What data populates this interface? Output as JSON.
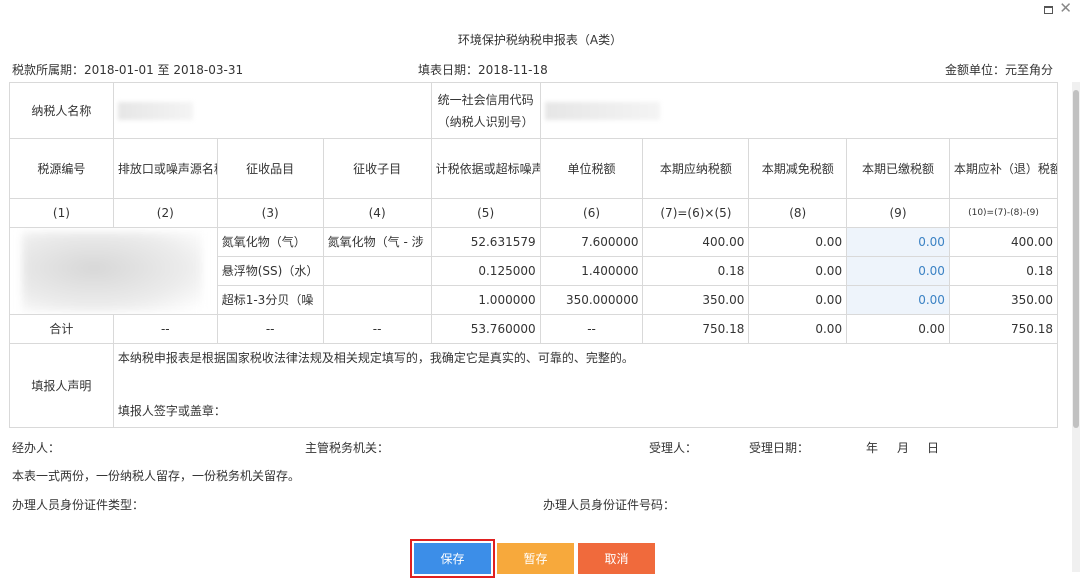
{
  "window": {
    "maximize_icon": "maximize-icon",
    "close_icon": "close-icon",
    "close_glyph": "✕"
  },
  "title": "环境保护税纳税申报表（A类）",
  "period": "税款所属期：2018-01-01 至 2018-03-31",
  "fill_date": "填表日期：2018-11-18",
  "unit": "金额单位：元至角分",
  "taxpayer": {
    "name_label": "纳税人名称",
    "credit_code_label_1": "统一社会信用代码",
    "credit_code_label_2": "（纳税人识别号）"
  },
  "headers": [
    "税源编号",
    "排放口或噪声源名称",
    "征收品目",
    "征收子目",
    "计税依据或超标噪声综合系数",
    "单位税额",
    "本期应纳税额",
    "本期减免税额",
    "本期已缴税额",
    "本期应补（退）税额"
  ],
  "header_index": [
    "(1)",
    "(2)",
    "(3)",
    "(4)",
    "(5)",
    "(6)",
    "(7)=(6)×(5)",
    "(8)",
    "(9)",
    "(10)=(7)-(8)-(9)"
  ],
  "rows": [
    {
      "item": "氮氧化物（气）",
      "subitem": "氮氧化物（气 - 涉",
      "basis": "52.631579",
      "unit_tax": "7.600000",
      "payable": "400.00",
      "reduced": "0.00",
      "paid": "0.00",
      "due": "400.00"
    },
    {
      "item": "悬浮物(SS)（水）",
      "subitem": "",
      "basis": "0.125000",
      "unit_tax": "1.400000",
      "payable": "0.18",
      "reduced": "0.00",
      "paid": "0.00",
      "due": "0.18"
    },
    {
      "item": "超标1-3分贝（噪",
      "subitem": "",
      "basis": "1.000000",
      "unit_tax": "350.000000",
      "payable": "350.00",
      "reduced": "0.00",
      "paid": "0.00",
      "due": "350.00"
    }
  ],
  "total": {
    "label": "合计",
    "c2": "--",
    "c3": "--",
    "c4": "--",
    "basis": "53.760000",
    "unit_tax": "--",
    "payable": "750.18",
    "reduced": "0.00",
    "paid": "0.00",
    "due": "750.18"
  },
  "declaration": {
    "label": "填报人声明",
    "text": "本纳税申报表是根据国家税收法律法规及相关规定填写的，我确定它是真实的、可靠的、完整的。",
    "sign": "填报人签字或盖章："
  },
  "footer": {
    "agent": "经办人：",
    "tax_office": "主管税务机关：",
    "receiver": "受理人：",
    "receive_date": "受理日期：",
    "year": "年",
    "month": "月",
    "day": "日",
    "copies": "本表一式两份，一份纳税人留存，一份税务机关留存。",
    "id_type": "办理人员身份证件类型：",
    "id_number": "办理人员身份证件号码："
  },
  "buttons": {
    "save": "保存",
    "draft": "暂存",
    "cancel": "取消"
  },
  "colors": {
    "save": "#3c8ee8",
    "draft": "#f7a93c",
    "cancel": "#f06a3c",
    "highlight": "#e02020",
    "paid_cell": "#3b82c4"
  }
}
